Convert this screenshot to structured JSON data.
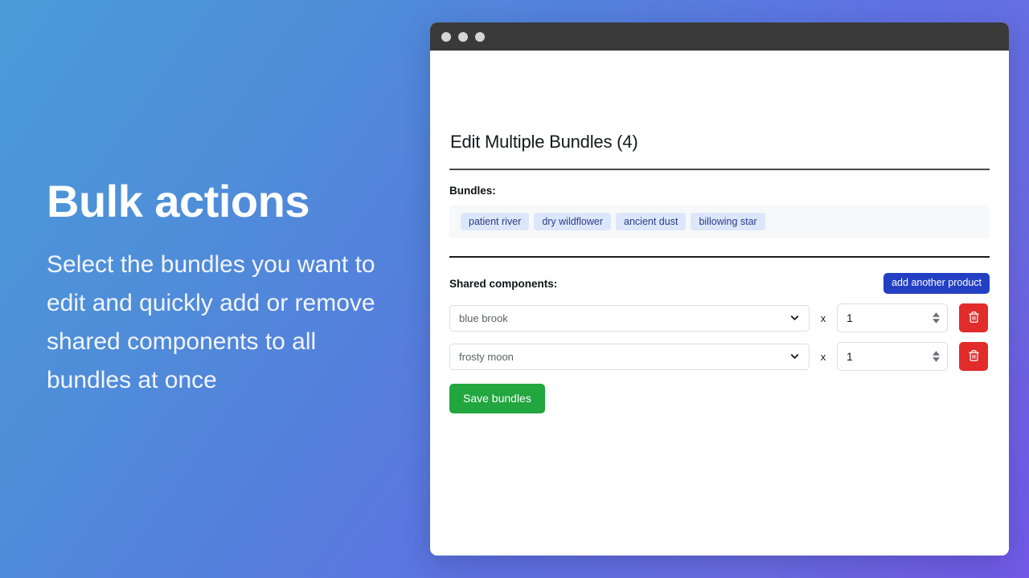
{
  "hero": {
    "title": "Bulk actions",
    "body": "Select the bundles you want to edit and quickly add or remove shared components to all bundles at once"
  },
  "window": {
    "traffic_lights": [
      "close",
      "minimize",
      "zoom"
    ],
    "page_title": "Edit Multiple Bundles (4)",
    "bundles": {
      "label": "Bundles:",
      "tags": [
        "patient river",
        "dry wildflower",
        "ancient dust",
        "billowing star"
      ]
    },
    "shared_components": {
      "label": "Shared components:",
      "add_button": "add another product",
      "rows": [
        {
          "product": "blue brook",
          "separator": "x",
          "quantity": "1",
          "delete_icon": "trash-icon"
        },
        {
          "product": "frosty moon",
          "separator": "x",
          "quantity": "1",
          "delete_icon": "trash-icon"
        }
      ]
    },
    "save_button": "Save bundles"
  },
  "colors": {
    "accent_blue": "#2340c4",
    "danger_red": "#e22b2b",
    "success_green": "#22a63f",
    "tag_bg": "#dde7fb",
    "tag_text": "#2c3b87",
    "titlebar": "#3a3a3a",
    "gradient_start": "#4a9bd8",
    "gradient_end": "#7359e8"
  }
}
